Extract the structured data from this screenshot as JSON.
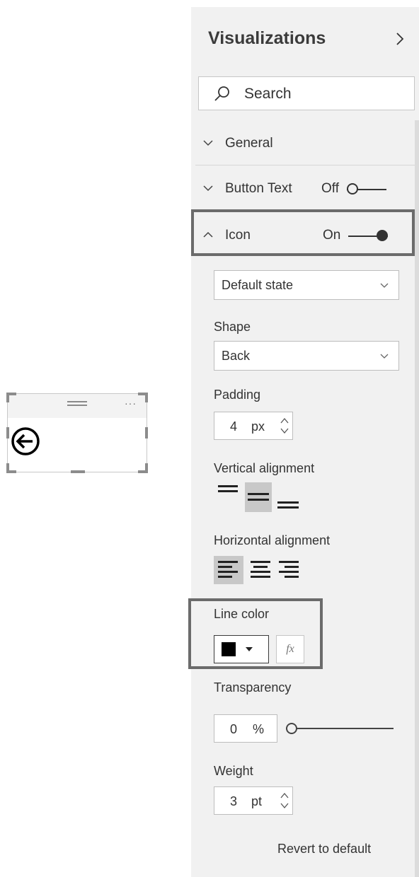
{
  "canvas": {
    "visual": {
      "more_glyph": "···",
      "icon": "back-arrow-icon"
    }
  },
  "panel": {
    "title": "Visualizations",
    "collapse_icon": "chevron-right-icon",
    "search": {
      "placeholder": "Search",
      "icon": "search-icon"
    },
    "sections": {
      "general": {
        "label": "General",
        "expanded": false
      },
      "button_text": {
        "label": "Button Text",
        "toggle_label": "Off",
        "on": false
      },
      "icon": {
        "label": "Icon",
        "toggle_label": "On",
        "on": true,
        "expanded": true
      }
    },
    "icon_settings": {
      "state": {
        "value": "Default state"
      },
      "shape": {
        "label": "Shape",
        "value": "Back"
      },
      "padding": {
        "label": "Padding",
        "value": "4",
        "unit": "px"
      },
      "vertical_alignment": {
        "label": "Vertical alignment",
        "options": [
          "top",
          "middle",
          "bottom"
        ],
        "selected": "middle"
      },
      "horizontal_alignment": {
        "label": "Horizontal alignment",
        "options": [
          "left",
          "center",
          "right"
        ],
        "selected": "left"
      },
      "line_color": {
        "label": "Line color",
        "color": "#000000",
        "fx_label": "fx"
      },
      "transparency": {
        "label": "Transparency",
        "value": "0",
        "unit": "%",
        "level": 0
      },
      "weight": {
        "label": "Weight",
        "value": "3",
        "unit": "pt"
      }
    },
    "revert_label": "Revert to default"
  },
  "colors": {
    "panel_bg": "#f1f1f1",
    "highlight_border": "#6b6b6b",
    "active_align_bg": "#c8c8c8"
  }
}
